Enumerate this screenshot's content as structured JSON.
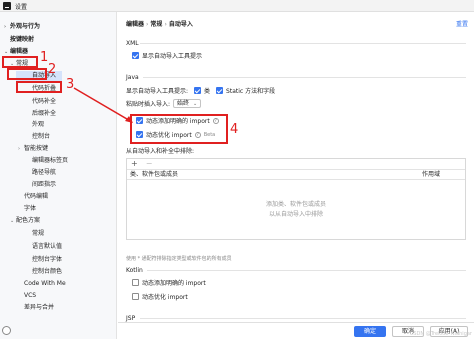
{
  "window": {
    "title": "设置"
  },
  "sidebar": {
    "items": [
      {
        "label": "外观与行为",
        "chev": "›",
        "bold": true
      },
      {
        "label": "按键映射",
        "chev": "",
        "bold": true
      },
      {
        "label": "编辑器",
        "chev": "⌄",
        "bold": true
      },
      {
        "label": "常规",
        "chev": "⌄",
        "bold": false
      },
      {
        "label": "自动导入",
        "chev": "",
        "bold": false
      },
      {
        "label": "代码折叠",
        "chev": "",
        "bold": false
      },
      {
        "label": "代码补全",
        "chev": "",
        "bold": false
      },
      {
        "label": "后缀补全",
        "chev": "",
        "bold": false
      },
      {
        "label": "外观",
        "chev": "",
        "bold": false
      },
      {
        "label": "控制台",
        "chev": "",
        "bold": false
      },
      {
        "label": "智能按键",
        "chev": "›",
        "bold": false
      },
      {
        "label": "编辑器标签页",
        "chev": "",
        "bold": false
      },
      {
        "label": "路径导航",
        "chev": "",
        "bold": false
      },
      {
        "label": "间距指示",
        "chev": "",
        "bold": false
      },
      {
        "label": "代码编辑",
        "chev": "",
        "bold": false
      },
      {
        "label": "字体",
        "chev": "",
        "bold": false
      },
      {
        "label": "配色方案",
        "chev": "⌄",
        "bold": false
      },
      {
        "label": "常规",
        "chev": "",
        "bold": false
      },
      {
        "label": "语言默认值",
        "chev": "",
        "bold": false
      },
      {
        "label": "控制台字体",
        "chev": "",
        "bold": false
      },
      {
        "label": "控制台颜色",
        "chev": "",
        "bold": false
      },
      {
        "label": "Code With Me",
        "chev": "",
        "bold": false
      },
      {
        "label": "VCS",
        "chev": "",
        "bold": false
      },
      {
        "label": "差异与合并",
        "chev": "",
        "bold": false
      }
    ]
  },
  "header": {
    "crumbs": [
      "编辑器",
      "常规",
      "自动导入"
    ],
    "sep": "›",
    "reset": "重置"
  },
  "xml": {
    "title": "XML",
    "show_popup": "显示自动导入工具提示"
  },
  "java": {
    "title": "Java",
    "show_popup_label": "显示自动导入工具提示:",
    "class_label": "类",
    "static_label": "Static 方法和字段",
    "paste_label": "粘贴时插入导入:",
    "paste_value": "始终",
    "opt_add": "动态添加明确的 import",
    "opt_optimize": "动态优化 import",
    "beta": "Beta",
    "exclude_label": "从自动导入和补全中排除:",
    "toolbar": [
      "+",
      "−"
    ],
    "col_class": "类、软件包或成员",
    "col_scope": "作用域",
    "empty1": "添加类、软件包或成员",
    "empty2": "以从自动导入中排除",
    "note": "使用 * 通配符排除指定类型或软件包的所有成员"
  },
  "kotlin": {
    "title": "Kotlin",
    "opt_add": "动态添加明确的 import",
    "opt_optimize": "动态优化 import"
  },
  "jsp": {
    "title": "JSP"
  },
  "footer": {
    "ok": "确定",
    "cancel": "取消",
    "apply": "应用(A)"
  },
  "annotations": [
    "1",
    "2",
    "3",
    "4"
  ],
  "watermark": "CSDN @Trekkle_Nidhigar",
  "colors": {
    "accent": "#3574f0",
    "annotation": "#e02020",
    "selected": "#d5e3fb"
  }
}
